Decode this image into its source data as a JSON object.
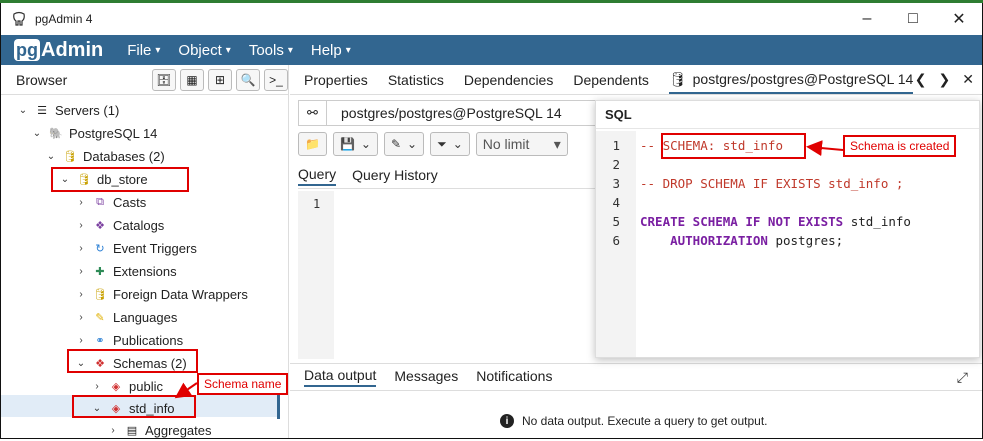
{
  "window": {
    "title": "pgAdmin 4",
    "controls": [
      "–",
      "□",
      "✕"
    ]
  },
  "menubar": {
    "logo_pg": "pg",
    "logo_rest": "Admin",
    "items": [
      {
        "label": "File"
      },
      {
        "label": "Object"
      },
      {
        "label": "Tools"
      },
      {
        "label": "Help"
      }
    ]
  },
  "browser": {
    "title": "Browser",
    "tree": [
      {
        "label": "Servers (1)"
      },
      {
        "label": "PostgreSQL 14"
      },
      {
        "label": "Databases (2)"
      },
      {
        "label": "db_store"
      },
      {
        "label": "Casts"
      },
      {
        "label": "Catalogs"
      },
      {
        "label": "Event Triggers"
      },
      {
        "label": "Extensions"
      },
      {
        "label": "Foreign Data Wrappers"
      },
      {
        "label": "Languages"
      },
      {
        "label": "Publications"
      },
      {
        "label": "Schemas (2)"
      },
      {
        "label": "public"
      },
      {
        "label": "std_info"
      },
      {
        "label": "Aggregates"
      }
    ]
  },
  "tabs": {
    "items": [
      "Properties",
      "Statistics",
      "Dependencies",
      "Dependents",
      "postgres/postgres@PostgreSQL 14"
    ],
    "nav": [
      "❮",
      "❯",
      "✕"
    ]
  },
  "query_tool": {
    "connection": "postgres/postgres@PostgreSQL 14",
    "limit": "No limit",
    "tabs": [
      "Query",
      "Query History"
    ],
    "editor_line": "1"
  },
  "output": {
    "tabs": [
      "Data output",
      "Messages",
      "Notifications"
    ],
    "empty_message": "No data output. Execute a query to get output."
  },
  "sql_panel": {
    "title": "SQL",
    "lines": [
      {
        "n": "1",
        "comment": "-- SCHEMA: std_info"
      },
      {
        "n": "2"
      },
      {
        "n": "3",
        "comment": "-- DROP SCHEMA IF EXISTS std_info ;"
      },
      {
        "n": "4"
      },
      {
        "n": "5",
        "kw": "CREATE SCHEMA IF NOT EXISTS",
        "rest": " std_info"
      },
      {
        "n": "6",
        "kw": "    AUTHORIZATION",
        "rest": " postgres;"
      }
    ]
  },
  "annotations": {
    "schema_created": "Schema is created",
    "schema_name": "Schema name",
    "color": "#e00000"
  }
}
